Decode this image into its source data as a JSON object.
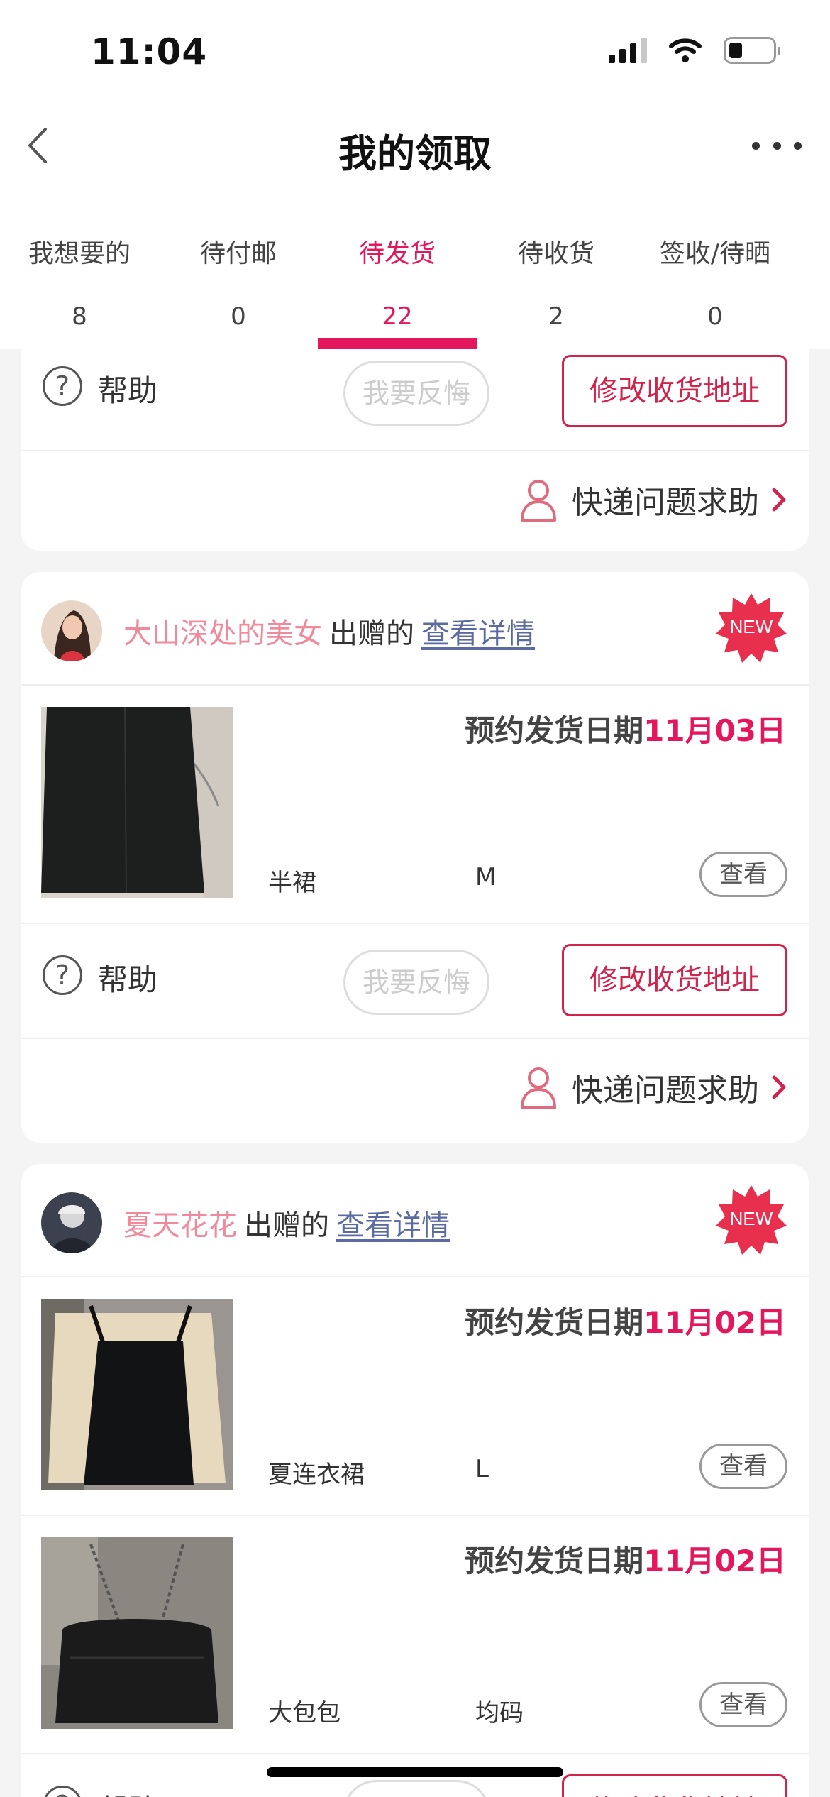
{
  "status": {
    "time": "11:04"
  },
  "nav": {
    "title": "我的领取"
  },
  "tabs": [
    {
      "label": "我想要的",
      "count": "8"
    },
    {
      "label": "待付邮",
      "count": "0"
    },
    {
      "label": "待发货",
      "count": "22",
      "active": true
    },
    {
      "label": "待收货",
      "count": "2"
    },
    {
      "label": "签收/待晒",
      "count": "0"
    }
  ],
  "actions": {
    "help": "帮助",
    "regret": "我要反悔",
    "change_address": "修改收货地址",
    "express_help": "快递问题求助",
    "view": "查看",
    "gift_text": "出赠的",
    "detail": "查看详情",
    "new_badge": "NEW",
    "ship_prefix": "预约发货日期"
  },
  "orders": [
    {
      "seller": "大山深处的美女",
      "items": [
        {
          "name": "半裙",
          "size": "M",
          "ship_date": "11月03日"
        }
      ]
    },
    {
      "seller": "夏天花花",
      "items": [
        {
          "name": "夏连衣裙",
          "size": "L",
          "ship_date": "11月02日"
        },
        {
          "name": "大包包",
          "size": "均码",
          "ship_date": "11月02日"
        }
      ]
    }
  ],
  "colors": {
    "accent": "#e4175c",
    "seller_name": "#f0899b",
    "link": "#5b6aa0"
  }
}
